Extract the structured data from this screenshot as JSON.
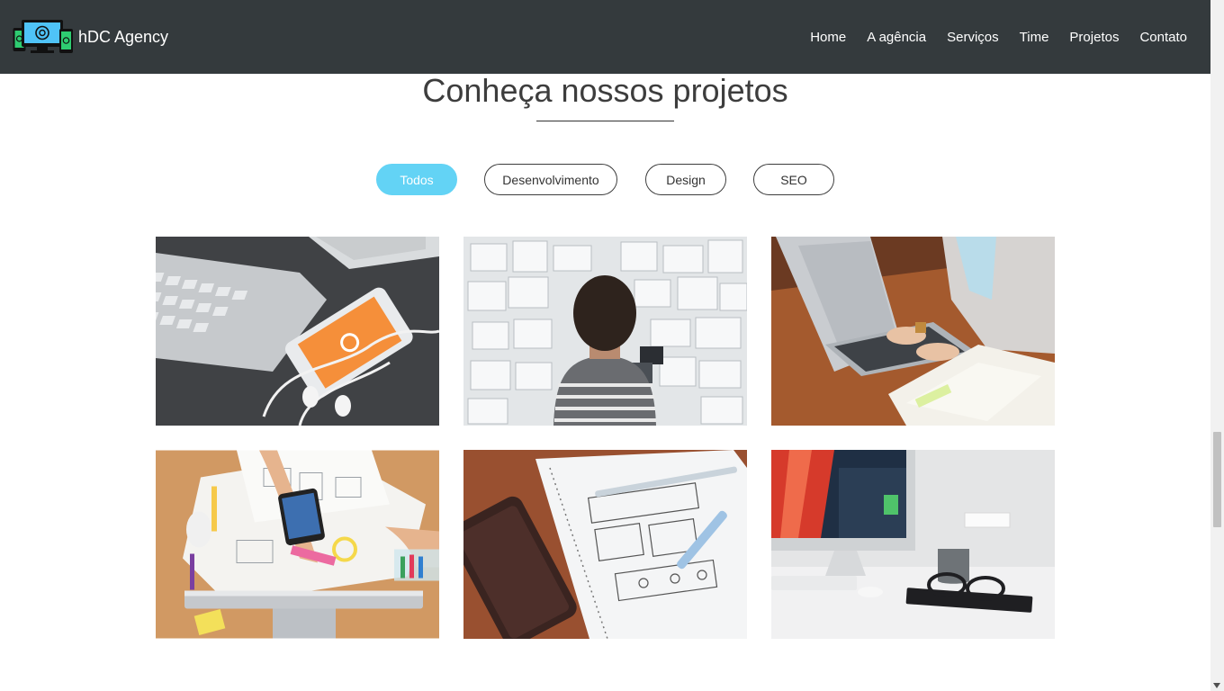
{
  "brand": {
    "name": "hDC Agency"
  },
  "nav": {
    "items": [
      {
        "label": "Home"
      },
      {
        "label": "A agência"
      },
      {
        "label": "Serviços"
      },
      {
        "label": "Time"
      },
      {
        "label": "Projetos"
      },
      {
        "label": "Contato"
      }
    ]
  },
  "section": {
    "title": "Conheça nossos projetos"
  },
  "filters": {
    "active": "Todos",
    "items": [
      {
        "label": "Todos"
      },
      {
        "label": "Desenvolvimento"
      },
      {
        "label": "Design"
      },
      {
        "label": "SEO"
      }
    ]
  },
  "gallery": {
    "items": [
      {
        "subject": "keyboard, smartphone and earphones on dark desk"
      },
      {
        "subject": "man looking at wall of design sketches"
      },
      {
        "subject": "person typing on laptop at wooden table"
      },
      {
        "subject": "hands sketching wireframes on desk"
      },
      {
        "subject": "notebook with wireframe sketches and phone"
      },
      {
        "subject": "desktop computer with glasses and notebook"
      }
    ]
  },
  "colors": {
    "navbar": "#343a3d",
    "accent": "#63d3f5",
    "title": "#3d3d3d"
  }
}
